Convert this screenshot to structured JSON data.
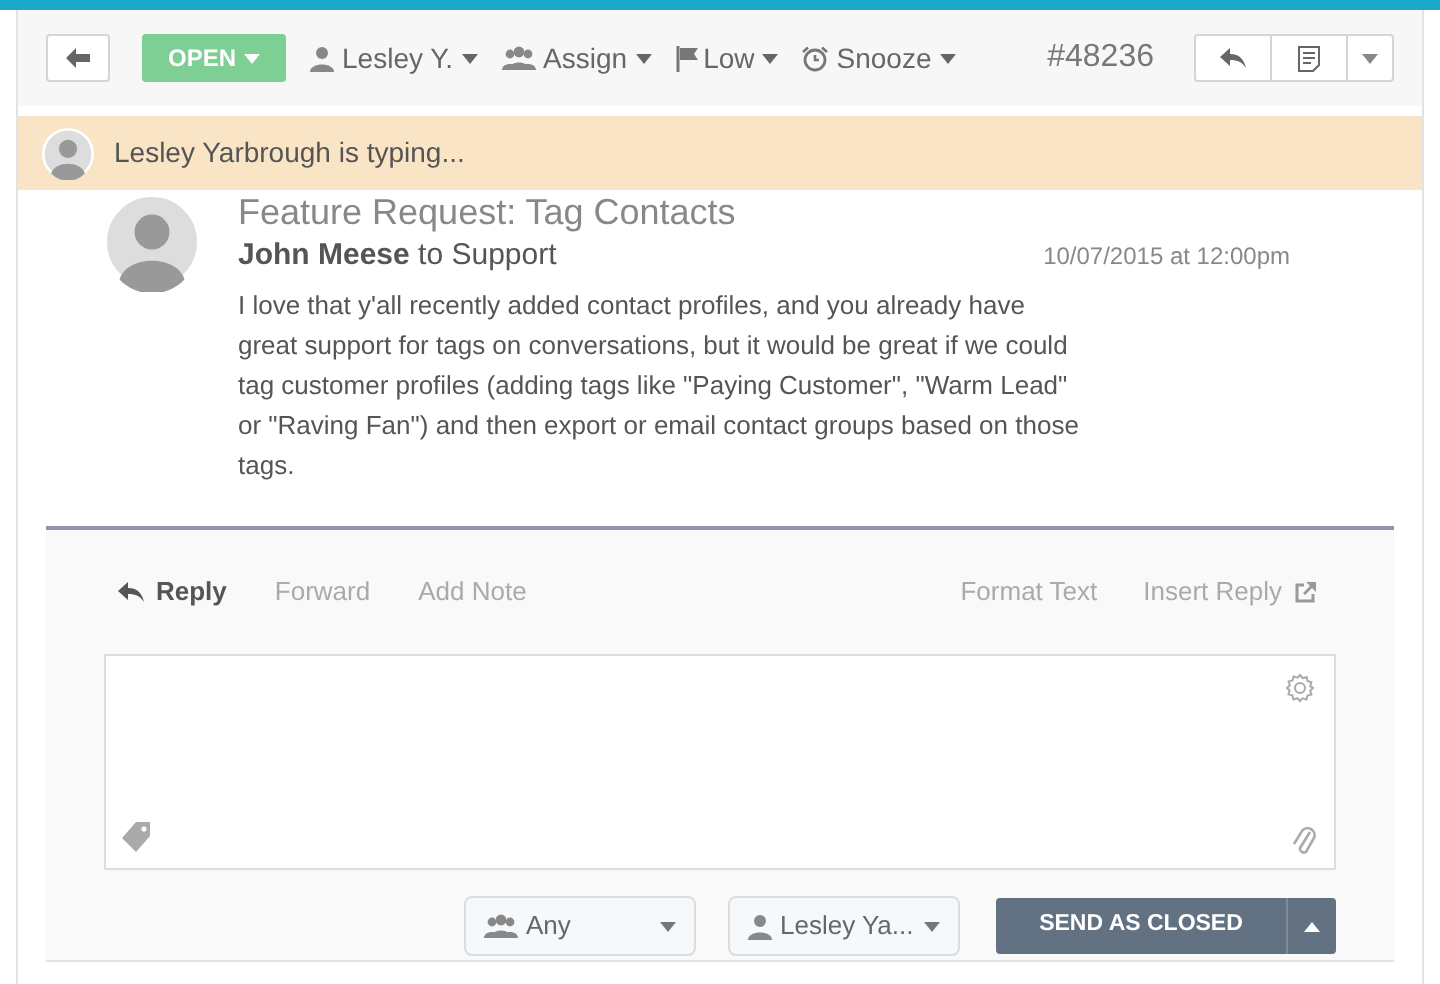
{
  "toolbar": {
    "status": "OPEN",
    "assignee": "Lesley Y.",
    "assign": "Assign",
    "priority": "Low",
    "snooze": "Snooze",
    "ticket_number": "#48236"
  },
  "typing_banner": {
    "text": "Lesley Yarbrough is typing..."
  },
  "conversation": {
    "title": "Feature Request: Tag Contacts",
    "sender": "John Meese",
    "recipient": "to Support",
    "date": "10/07/2015 at 12:00pm",
    "body": "I love that y'all recently added contact profiles, and you already have great support for tags on conversations, but it would be great if we could tag customer profiles (adding tags like \"Paying Customer\", \"Warm Lead\" or \"Raving Fan\") and then export or email contact groups based on those tags."
  },
  "reply": {
    "tabs": [
      {
        "label": "Reply",
        "selected": true
      },
      {
        "label": "Forward",
        "selected": false
      },
      {
        "label": "Add Note",
        "selected": false
      }
    ],
    "tools": [
      "Format Text",
      "Insert Reply"
    ],
    "team_select": "Any",
    "user_select": "Lesley Ya...",
    "send_button": "SEND AS CLOSED"
  }
}
